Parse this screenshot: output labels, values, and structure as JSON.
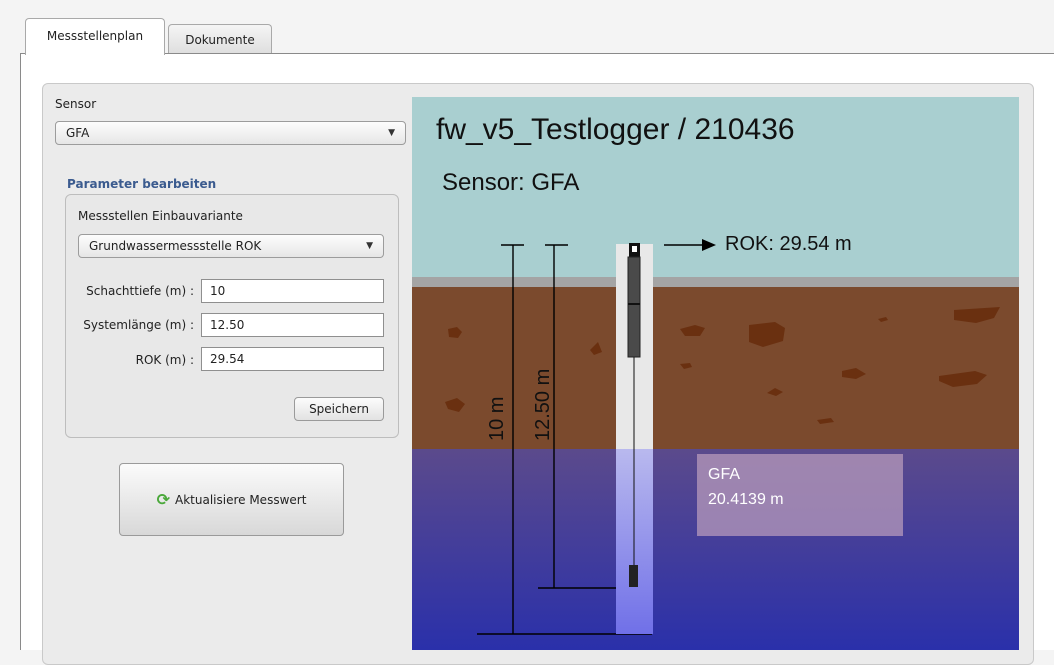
{
  "tabs": [
    {
      "label": "Messstellenplan"
    },
    {
      "label": "Dokumente"
    }
  ],
  "sensor": {
    "label": "Sensor",
    "selected": "GFA"
  },
  "parameters": {
    "title": "Parameter bearbeiten",
    "variant_label": "Messstellen Einbauvariante",
    "variant_selected": "Grundwassermessstelle ROK",
    "schachttiefe_label": "Schachttiefe (m) :",
    "schachttiefe_value": "10",
    "systemlaenge_label": "Systemlänge (m) :",
    "systemlaenge_value": "12.50",
    "rok_label": "ROK (m) :",
    "rok_value": "29.54",
    "save_label": "Speichern"
  },
  "update_button": {
    "label": "Aktualisiere Messwert",
    "icon": "refresh-icon"
  },
  "diagram": {
    "title": "fw_v5_Testlogger / 210436",
    "sensor_line": "Sensor: GFA",
    "rok_line": "ROK: 29.54 m",
    "schacht_label": "10 m",
    "system_label": "12.50 m",
    "reading_sensor": "GFA",
    "reading_value": "20.4139 m",
    "colors": {
      "sky": "#a9cfd0",
      "soil": "#7b4a2d",
      "rock": "#6a3010",
      "water_top": "#5a4a8e",
      "water_bottom": "#2a2fa8"
    }
  }
}
